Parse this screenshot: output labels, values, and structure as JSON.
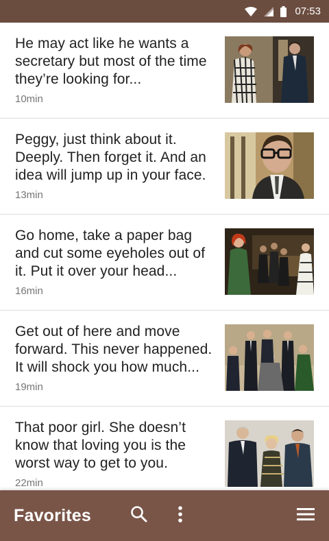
{
  "status_bar": {
    "time": "07:53",
    "icons": [
      "wifi-icon",
      "signal-icon",
      "battery-icon"
    ]
  },
  "feed": {
    "items": [
      {
        "title": "He may act like he wants a secretary but most of the time they’re looking for...",
        "duration": "10min",
        "thumbnail": "couple-office-photo"
      },
      {
        "title": "Peggy, just think about it. Deeply. Then forget it. And an idea will jump up in your face.",
        "duration": "13min",
        "thumbnail": "man-glasses-photo"
      },
      {
        "title": "Go home, take a paper bag and cut some eyeholes out of it. Put it over your head...",
        "duration": "16min",
        "thumbnail": "office-party-photo"
      },
      {
        "title": "Get out of here and move forward. This never happened. It will shock you how much...",
        "duration": "19min",
        "thumbnail": "cast-group-photo"
      },
      {
        "title": "That poor girl. She doesn’t know that loving you is the worst way to get to you.",
        "duration": "22min",
        "thumbnail": "three-people-photo"
      }
    ]
  },
  "app_bar": {
    "title": "Favorites",
    "icons": [
      "search-icon",
      "more-vert-icon",
      "menu-icon"
    ],
    "color": "#795548"
  },
  "colors": {
    "status_bar": "#6b4d40",
    "app_bar": "#795548",
    "divider": "#dcdcdc",
    "meta_text": "#757575"
  }
}
